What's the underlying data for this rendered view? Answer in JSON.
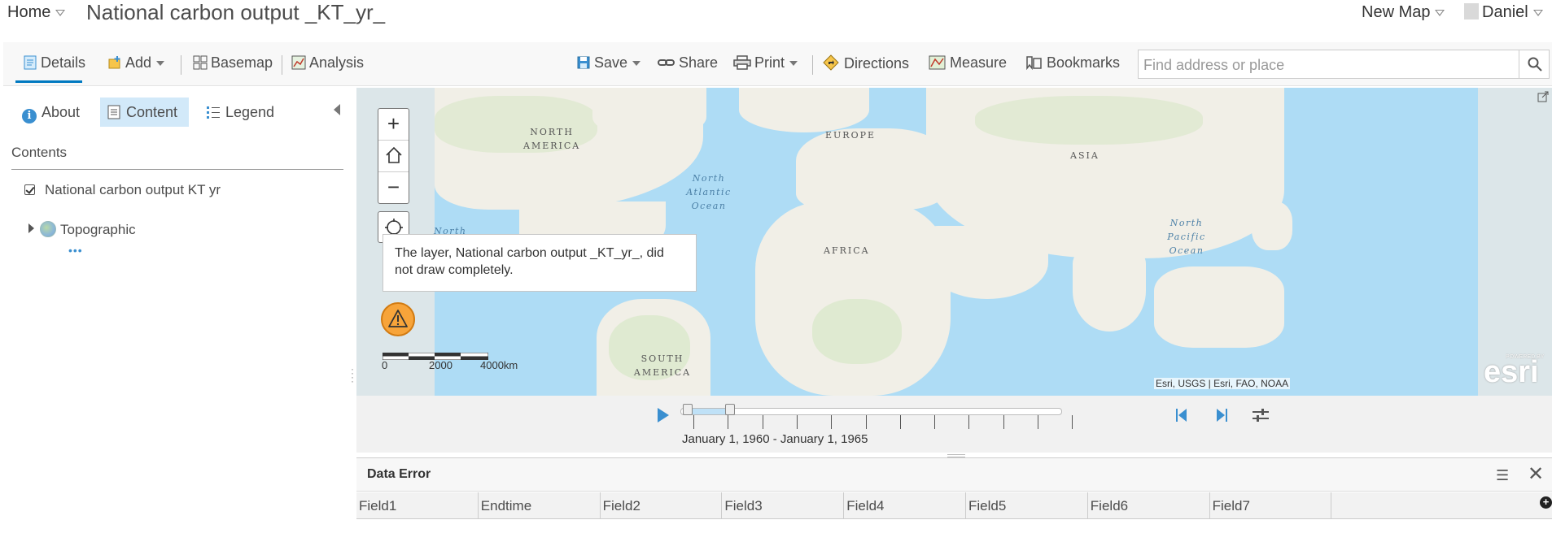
{
  "header": {
    "home_label": "Home",
    "map_title": "National carbon output _KT_yr_",
    "new_map_label": "New Map",
    "user_name": "Daniel"
  },
  "toolbar": {
    "details": "Details",
    "add": "Add",
    "basemap": "Basemap",
    "analysis": "Analysis",
    "save": "Save",
    "share": "Share",
    "print": "Print",
    "directions": "Directions",
    "measure": "Measure",
    "bookmarks": "Bookmarks",
    "search_placeholder": "Find address or place"
  },
  "leftpanel": {
    "tabs": [
      {
        "label": "About",
        "active": false
      },
      {
        "label": "Content",
        "active": true
      },
      {
        "label": "Legend",
        "active": false
      }
    ],
    "contents_heading": "Contents",
    "layers": [
      {
        "label": "National carbon output KT yr",
        "checked": true
      },
      {
        "label": "Topographic"
      }
    ]
  },
  "map": {
    "labels": {
      "north_america": "NORTH AMERICA",
      "europe": "EUROPE",
      "asia": "ASIA",
      "africa": "AFRICA",
      "south_america": "SOUTH AMERICA",
      "north_atlantic": "North Atlantic Ocean",
      "north_pacific": "North Pacific Ocean",
      "north_partial": "North"
    },
    "error_tooltip": "The layer, National carbon output _KT_yr_, did not draw completely.",
    "scale": {
      "ticks": [
        "0",
        "2000",
        "4000km"
      ]
    },
    "attribution": "Esri, USGS | Esri, FAO, NOAA",
    "logo_text": "esri",
    "logo_powered": "POWERED BY"
  },
  "timeslider": {
    "range_label": "January 1, 1960 - January 1, 1965",
    "accent_color": "#3a8fd0"
  },
  "datatable": {
    "title": "Data Error",
    "columns": [
      "Field1",
      "Endtime",
      "Field2",
      "Field3",
      "Field4",
      "Field5",
      "Field6",
      "Field7"
    ]
  }
}
